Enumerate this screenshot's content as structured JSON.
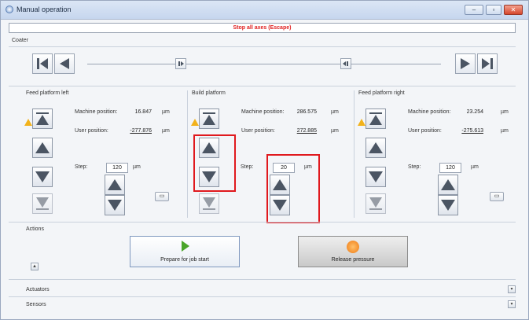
{
  "window": {
    "title": "Manual operation",
    "controls": {
      "minimize": "–",
      "restore": "▫",
      "close": "✕"
    }
  },
  "stop_all": "Stop all axes (Escape)",
  "coater": {
    "label": "Coater",
    "icons": [
      "skip-to-start-icon",
      "step-left-icon",
      "pause-left-icon",
      "pause-right-icon",
      "step-right-icon",
      "skip-to-end-icon"
    ]
  },
  "panels": [
    {
      "title": "Feed platform left",
      "machine_position_label": "Machine position:",
      "machine_position": "16.847",
      "user_position_label": "User position:",
      "user_position": "-277.876",
      "unit": "µm",
      "step_label": "Step:",
      "step_value": "120",
      "step_unit": "µm"
    },
    {
      "title": "Build platform",
      "machine_position_label": "Machine position:",
      "machine_position": "286.575",
      "user_position_label": "User position:",
      "user_position": "272.885",
      "unit": "µm",
      "step_label": "Step:",
      "step_value": "20",
      "step_unit": "µm"
    },
    {
      "title": "Feed platform right",
      "machine_position_label": "Machine position:",
      "machine_position": "23.254",
      "user_position_label": "User position:",
      "user_position": "-275.613",
      "unit": "µm",
      "step_label": "Step:",
      "step_value": "120",
      "step_unit": "µm"
    }
  ],
  "actions": {
    "label": "Actions",
    "prepare_label": "Prepare for job start",
    "release_label": "Release pressure"
  },
  "collapsed_sections": [
    "Actuators",
    "Sensors"
  ],
  "colors": {
    "highlight": "#e0191e",
    "warning": "#f2b21b",
    "stop_text": "#e02020"
  }
}
